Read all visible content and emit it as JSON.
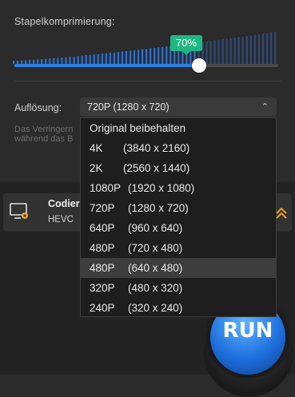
{
  "batch": {
    "title": "Stapelkomprimierung:",
    "percent_label": "70%",
    "value": 0.7
  },
  "resolution": {
    "label": "Auflösung:",
    "selected_value": "720P   (1280 x 720)",
    "hint_line1": "Das Verringern",
    "hint_line2": "während das B",
    "options": [
      {
        "name": "Original beibehalten",
        "dims": ""
      },
      {
        "name": "4K",
        "dims": "(3840 x 2160)"
      },
      {
        "name": "2K",
        "dims": "(2560 x 1440)"
      },
      {
        "name": "1080P",
        "dims": "(1920 x 1080)"
      },
      {
        "name": "720P",
        "dims": "(1280 x 720)"
      },
      {
        "name": "640P",
        "dims": "(960 x 640)"
      },
      {
        "name": "480P",
        "dims": "(720 x 480)"
      },
      {
        "name": "480P",
        "dims": "(640 x 480)"
      },
      {
        "name": "320P",
        "dims": "(480 x 320)"
      },
      {
        "name": "240P",
        "dims": "(320 x 240)"
      }
    ],
    "highlighted_index": 7
  },
  "codec": {
    "title": "Codier",
    "value": "HEVC"
  },
  "run_label": "RUN",
  "icons": {
    "monitor": "monitor-gear-icon",
    "collapse": "double-chevron-up-icon",
    "select_arrow": "updown-chevron-icon"
  },
  "colors": {
    "accent_blue": "#2d7fe0",
    "badge_green": "#1fb883",
    "orange": "#f0a020"
  }
}
